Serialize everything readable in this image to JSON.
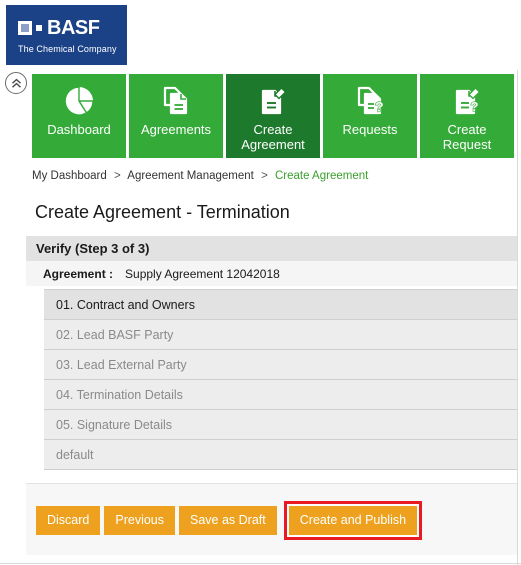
{
  "brand": {
    "logo_word": "BASF",
    "logo_tagline": "The Chemical Company",
    "blue": "#1b4287",
    "green": "#34ab38",
    "green_dark": "#1d7a2c",
    "orange": "#eda11e",
    "highlight_red": "#e81b23"
  },
  "collapse_toggle": {
    "icon": "double-chevron-up-icon"
  },
  "nav": {
    "tiles": [
      {
        "label": "Dashboard",
        "icon": "pie-chart-icon",
        "active": false
      },
      {
        "label": "Agreements",
        "icon": "documents-icon",
        "active": false
      },
      {
        "label": "Create Agreement",
        "icon": "document-pencil-icon",
        "active": true
      },
      {
        "label": "Requests",
        "icon": "documents-question-icon",
        "active": false
      },
      {
        "label": "Create Request",
        "icon": "document-pencil-question-icon",
        "active": false
      }
    ]
  },
  "breadcrumb": {
    "items": [
      {
        "label": "My Dashboard",
        "current": false
      },
      {
        "label": "Agreement Management",
        "current": false
      },
      {
        "label": "Create Agreement",
        "current": true
      }
    ],
    "separator": ">"
  },
  "page": {
    "title": "Create Agreement - Termination"
  },
  "form": {
    "step_header": "Verify (Step 3 of 3)",
    "agreement_label": "Agreement :",
    "agreement_value": "Supply Agreement 12042018",
    "sections": [
      {
        "label": "01. Contract and Owners",
        "active": true
      },
      {
        "label": "02. Lead BASF Party",
        "active": false
      },
      {
        "label": "03. Lead External Party",
        "active": false
      },
      {
        "label": "04. Termination Details",
        "active": false
      },
      {
        "label": "05. Signature Details",
        "active": false
      },
      {
        "label": "default",
        "active": false
      }
    ]
  },
  "actions": {
    "discard": "Discard",
    "previous": "Previous",
    "save_as_draft": "Save as Draft",
    "create_and_publish": "Create and Publish"
  }
}
